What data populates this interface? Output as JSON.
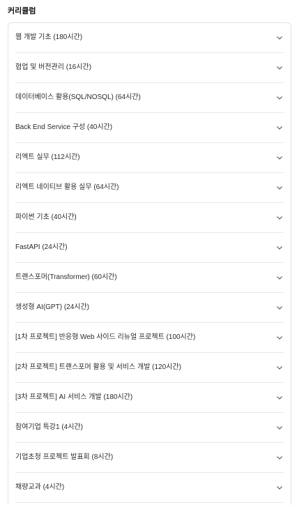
{
  "section": {
    "title": "커리큘럼"
  },
  "curriculum": {
    "items": [
      {
        "label": "웹 개발 기초 (180시간)",
        "icon": "chevron-down-icon"
      },
      {
        "label": "협업 및 버전관리 (16시간)",
        "icon": "chevron-down-icon"
      },
      {
        "label": "데이터베이스 활용(SQL/NOSQL) (64시간)",
        "icon": "chevron-down-icon"
      },
      {
        "label": "Back End Service 구성 (40시간)",
        "icon": "chevron-down-icon"
      },
      {
        "label": "리엑트 실무 (112시간)",
        "icon": "chevron-down-icon"
      },
      {
        "label": "리엑트 네이티브 활용 실무 (64시간)",
        "icon": "chevron-down-icon"
      },
      {
        "label": "파이썬 기초 (40시간)",
        "icon": "chevron-down-icon"
      },
      {
        "label": "FastAPI (24시간)",
        "icon": "chevron-down-icon"
      },
      {
        "label": "트랜스포머(Transformer) (60시간)",
        "icon": "chevron-down-icon"
      },
      {
        "label": "생성형 AI(GPT) (24시간)",
        "icon": "chevron-down-icon"
      },
      {
        "label": "[1차 프로젝트] 반응형 Web 사이드 리뉴얼 프로젝트 (100시간)",
        "icon": "chevron-down-icon"
      },
      {
        "label": "[2차 프로젝트] 트랜스포머 활용 및 서비스 개발 (120시간)",
        "icon": "chevron-down-icon"
      },
      {
        "label": "[3차 프로젝트] AI 서비스 개발 (180시간)",
        "icon": "chevron-down-icon"
      },
      {
        "label": "참여기업 특강1 (4시간)",
        "icon": "chevron-down-icon"
      },
      {
        "label": "기업초청 프로젝트 발표회 (8시간)",
        "icon": "chevron-down-icon"
      },
      {
        "label": "채량교과 (4시간)",
        "icon": "chevron-down-icon"
      }
    ]
  },
  "colors": {
    "border": "#e3e3e3",
    "divider": "#e8e8e8",
    "text": "#2a2a2a",
    "chevron": "#555555"
  }
}
